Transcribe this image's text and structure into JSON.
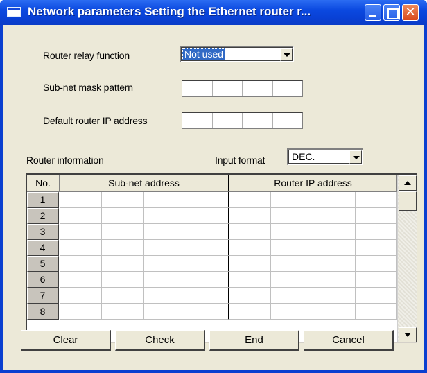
{
  "window": {
    "title": "Network parameters  Setting the Ethernet router r...",
    "close_glyph": "✕",
    "buttons": [
      "minimize-icon",
      "maximize-icon",
      "close-icon"
    ],
    "title_color": "#0a46e0"
  },
  "form": {
    "router_relay_label": "Router relay function",
    "router_relay_value": "Not used",
    "subnet_mask_label": "Sub-net mask pattern",
    "default_router_label": "Default router IP address"
  },
  "router_info": {
    "label": "Router information",
    "input_format_label": "Input format",
    "input_format_value": "DEC."
  },
  "table": {
    "headers": {
      "no": "No.",
      "subnet": "Sub-net address",
      "router_ip": "Router IP address"
    },
    "rows": [
      "1",
      "2",
      "3",
      "4",
      "5",
      "6",
      "7",
      "8"
    ]
  },
  "actions": {
    "clear": "Clear",
    "check": "Check",
    "end": "End",
    "cancel": "Cancel"
  }
}
